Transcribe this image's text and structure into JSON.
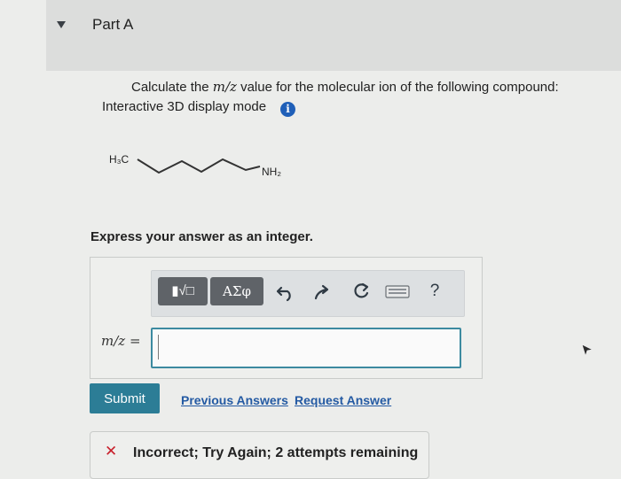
{
  "part": {
    "title": "Part A"
  },
  "question": {
    "prefix": "Calculate the ",
    "mz": "m/z",
    "suffix": " value for the molecular ion of the following compound:",
    "display_mode": "Interactive 3D display mode",
    "info_icon": "i"
  },
  "molecule": {
    "left_group": "H₃C",
    "right_group": "NH₂"
  },
  "instructions": "Express your answer as an integer.",
  "toolbar": {
    "templates_label": "▮√□",
    "greek_label": "ΑΣφ",
    "undo_icon": "undo-icon",
    "redo_icon": "redo-icon",
    "reset_icon": "reset-icon",
    "keyboard_icon": "keyboard-icon",
    "help_label": "?"
  },
  "answer": {
    "label": "m/z =",
    "value": ""
  },
  "actions": {
    "submit_label": "Submit",
    "previous_answers_label": "Previous Answers",
    "request_answer_label": "Request Answer"
  },
  "feedback": {
    "icon": "✕",
    "text": "Incorrect; Try Again; 2 attempts remaining"
  },
  "colors": {
    "submit": "#2c7d96",
    "link": "#245aa3",
    "error": "#c8202b",
    "input_border": "#3c8aa0",
    "info": "#1f5fb8"
  }
}
